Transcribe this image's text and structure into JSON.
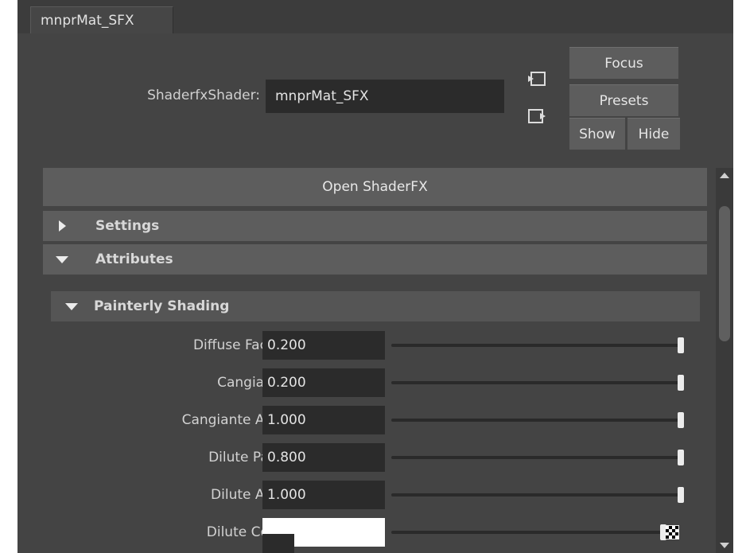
{
  "window": {
    "tab_label": "mnprMat_SFX"
  },
  "header": {
    "shader_type_label": "ShaderfxShader:",
    "shader_name": "mnprMat_SFX",
    "icons": [
      "input-connections-icon",
      "output-connections-icon"
    ],
    "buttons": {
      "focus": "Focus",
      "presets": "Presets",
      "show": "Show",
      "hide": "Hide"
    }
  },
  "main": {
    "open_button": "Open ShaderFX",
    "sections": [
      {
        "label": "Settings",
        "expanded": false
      },
      {
        "label": "Attributes",
        "expanded": true
      }
    ],
    "subsection": {
      "label": "Painterly Shading",
      "expanded": true
    },
    "attributes": [
      {
        "label": "Diffuse Factor",
        "value": "0.200",
        "slider_fraction": 1.0
      },
      {
        "label": "Cangiante",
        "value": "0.200",
        "slider_fraction": 1.0
      },
      {
        "label": "Cangiante Area",
        "value": "1.000",
        "slider_fraction": 1.0
      },
      {
        "label": "Dilute Paint",
        "value": "0.800",
        "slider_fraction": 1.0
      },
      {
        "label": "Dilute Area",
        "value": "1.000",
        "slider_fraction": 1.0
      }
    ],
    "color_attribute": {
      "label": "Dilute Color",
      "swatch_color": "#ffffff",
      "slider_fraction": 1.0
    }
  },
  "colors": {
    "panel": "#444444",
    "button": "#5d5d5d",
    "field": "#2b2b2b",
    "text": "#d6d6d6"
  }
}
